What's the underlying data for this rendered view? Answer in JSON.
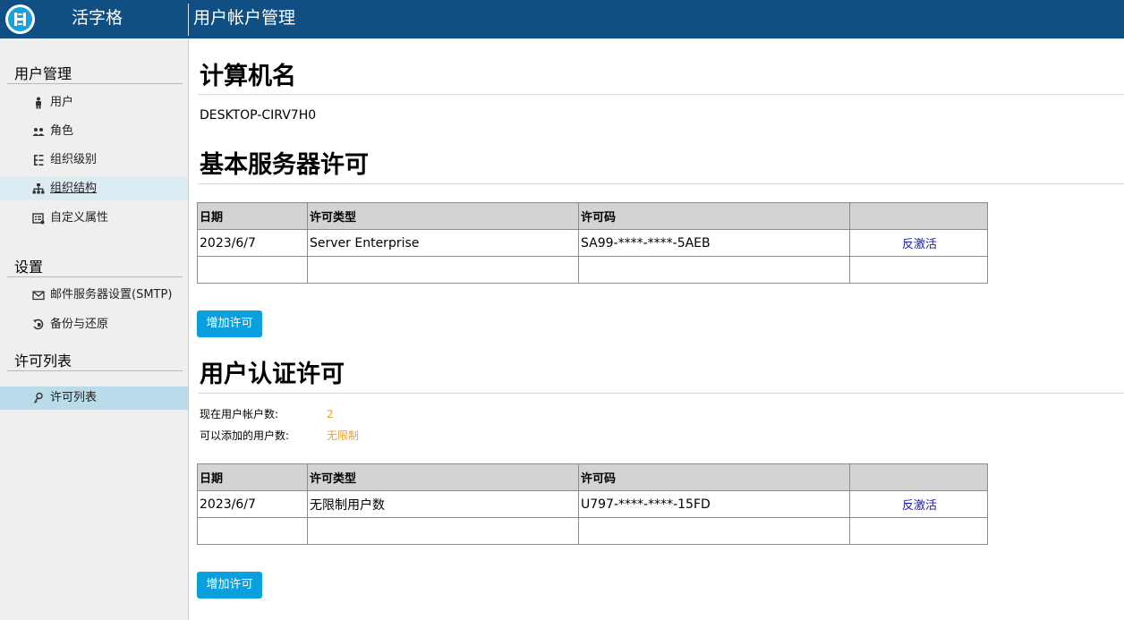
{
  "header": {
    "app_name": "活字格",
    "page_title": "用户帐户管理"
  },
  "sidebar": {
    "sections": [
      {
        "title": "用户管理",
        "items": [
          {
            "label": "用户",
            "icon": "user-icon"
          },
          {
            "label": "角色",
            "icon": "roles-icon"
          },
          {
            "label": "组织级别",
            "icon": "org-level-icon"
          },
          {
            "label": "组织结构",
            "icon": "org-structure-icon"
          },
          {
            "label": "自定义属性",
            "icon": "custom-attributes-icon"
          }
        ]
      },
      {
        "title": "设置",
        "items": [
          {
            "label": "邮件服务器设置(SMTP)",
            "icon": "mail-icon"
          },
          {
            "label": "备份与还原",
            "icon": "backup-restore-icon"
          }
        ]
      },
      {
        "title": "许可列表",
        "items": [
          {
            "label": "许可列表",
            "icon": "key-icon"
          }
        ]
      }
    ],
    "hovered_item": "组织结构",
    "active_item": "许可列表"
  },
  "main": {
    "computer_name_heading": "计算机名",
    "computer_name": "DESKTOP-CIRV7H0",
    "server_license": {
      "heading": "基本服务器许可",
      "columns": [
        "日期",
        "许可类型",
        "许可码",
        ""
      ],
      "rows": [
        {
          "date": "2023/6/7",
          "type": "Server Enterprise",
          "code": "SA99-****-****-5AEB",
          "action": "反激活"
        }
      ],
      "add_button": "增加许可"
    },
    "user_license": {
      "heading": "用户认证许可",
      "current_users_label": "现在用户帐户数:",
      "current_users_value": "2",
      "addable_users_label": "可以添加的用户数:",
      "addable_users_value": "无限制",
      "columns": [
        "日期",
        "许可类型",
        "许可码",
        ""
      ],
      "rows": [
        {
          "date": "2023/6/7",
          "type": "无限制用户数",
          "code": "U797-****-****-15FD",
          "action": "反激活"
        }
      ],
      "add_button": "增加许可"
    }
  },
  "colors": {
    "header_bg": "#0f4f84",
    "sidebar_bg": "#efefef",
    "button_bg": "#0aa0de",
    "link": "#1a1aa6",
    "stat_value": "#f0a030",
    "active_item_bg": "#b9dbea"
  }
}
